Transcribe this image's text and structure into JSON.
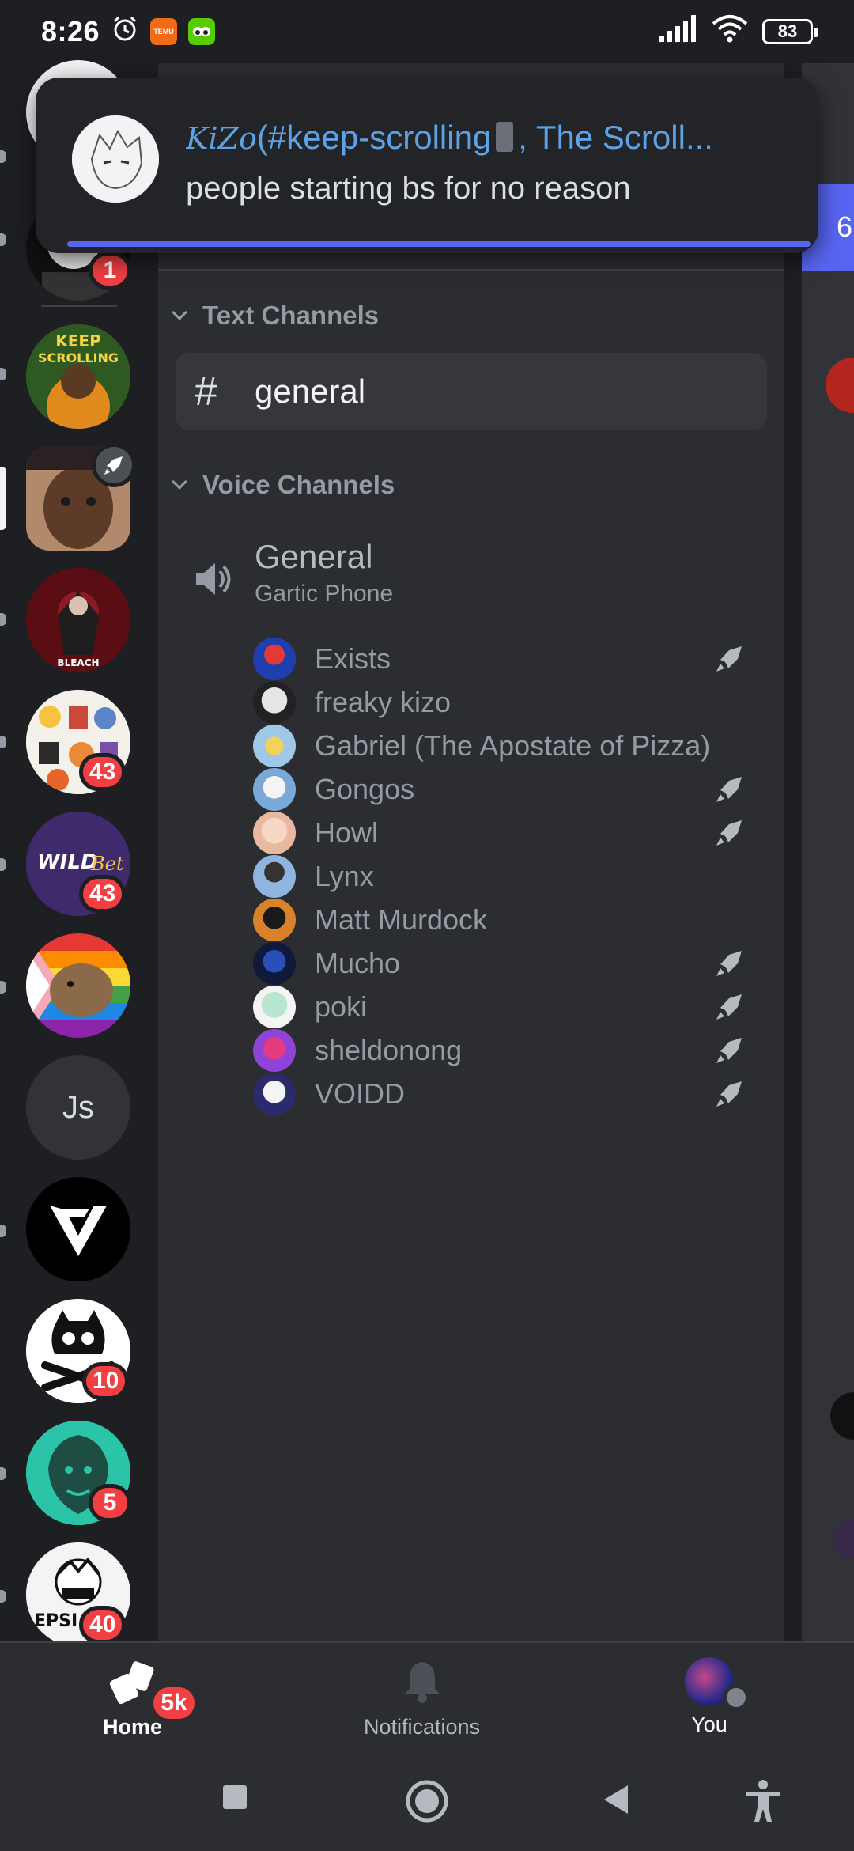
{
  "status_bar": {
    "time": "8:26",
    "battery": "83",
    "temu_label": "TEMU"
  },
  "notification": {
    "sender": "KiZo",
    "title_rest": "(#keep-scrolling",
    "title_tail": ", The Scroll...",
    "message": "people starting bs for no reason"
  },
  "servers": [
    {
      "name": "server-kizo",
      "badge": "1"
    },
    {
      "name": "server-keep-scrolling",
      "badge": ""
    },
    {
      "name": "server-person",
      "badge": ""
    },
    {
      "name": "server-bleach",
      "badge": ""
    },
    {
      "name": "server-stickers",
      "badge": "43"
    },
    {
      "name": "server-wildbet",
      "badge": "43"
    },
    {
      "name": "server-capybara",
      "badge": ""
    },
    {
      "name": "server-js",
      "initials": "Js",
      "badge": ""
    },
    {
      "name": "server-v",
      "badge": ""
    },
    {
      "name": "server-skull",
      "badge": "10"
    },
    {
      "name": "server-lion",
      "badge": "5"
    },
    {
      "name": "server-epsi",
      "badge": "40"
    }
  ],
  "server_badges": {
    "kizo": "1",
    "stickers": "43",
    "wildbet": "43",
    "skull": "10",
    "lion": "5",
    "epsi": "40"
  },
  "server_text": {
    "js": "Js",
    "bleach": "BLEACH",
    "keep": "KEEP",
    "scrolling": "SCROLLING",
    "wild": "WILD",
    "bet": "Bet",
    "epsi": "EPSI"
  },
  "channels": {
    "text_category": "Text Channels",
    "general_text": "general",
    "voice_category": "Voice Channels",
    "voice_channel": "General",
    "voice_activity": "Gartic Phone"
  },
  "voice_users": [
    {
      "name": "Exists",
      "boost": true
    },
    {
      "name": "freaky kizo",
      "boost": false
    },
    {
      "name": "Gabriel (The Apostate of Pizza)",
      "boost": false
    },
    {
      "name": "Gongos",
      "boost": true
    },
    {
      "name": "Howl",
      "boost": true
    },
    {
      "name": "Lynx",
      "boost": false
    },
    {
      "name": "Matt Murdock",
      "boost": false
    },
    {
      "name": "Mucho",
      "boost": true
    },
    {
      "name": "poki",
      "boost": true
    },
    {
      "name": "sheldonong",
      "boost": true
    },
    {
      "name": "VOIDD",
      "boost": true
    }
  ],
  "peek": {
    "text": "6"
  },
  "bottom_nav": {
    "home": "Home",
    "home_badge": "5k",
    "notifications": "Notifications",
    "you": "You"
  },
  "colors": {
    "accent": "#5865f2",
    "badge": "#f23f43",
    "link": "#5ea2e6"
  }
}
